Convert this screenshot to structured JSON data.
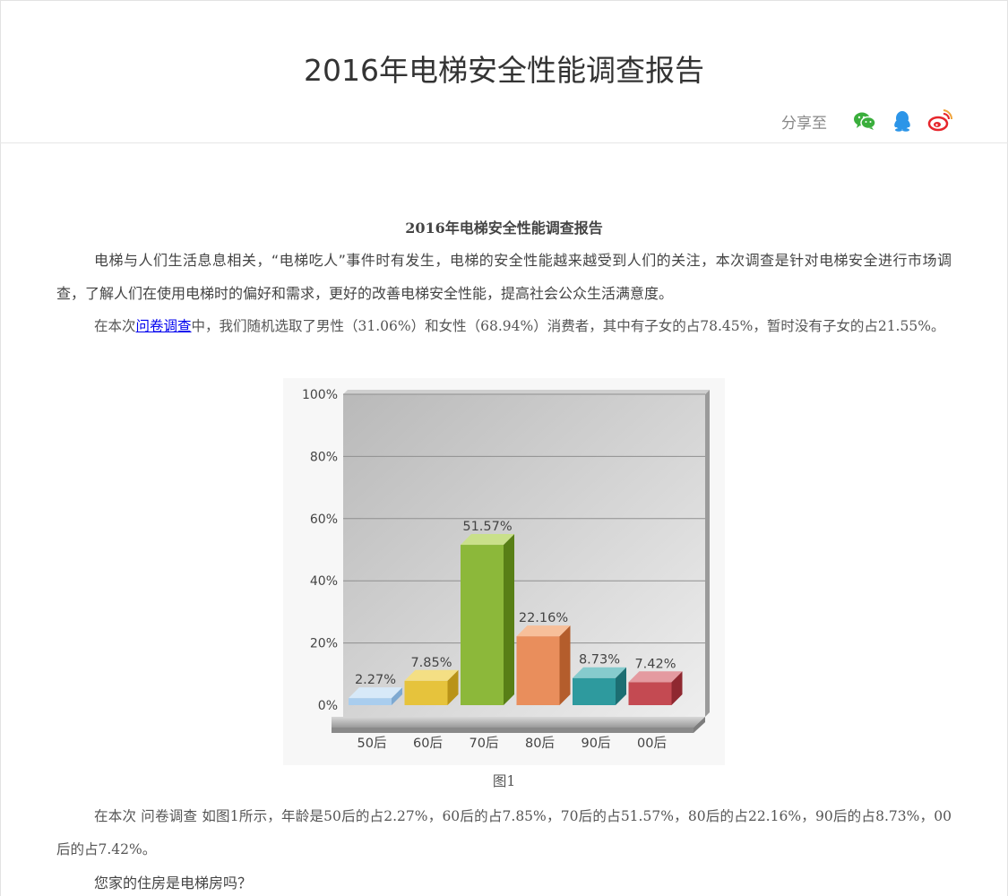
{
  "header": {
    "title": "2016年电梯安全性能调查报告",
    "share_label": "分享至",
    "share_icons": [
      "wechat-icon",
      "qq-icon",
      "weibo-icon"
    ]
  },
  "article": {
    "heading": "2016年电梯安全性能调查报告",
    "para1": "电梯与人们生活息息相关，“电梯吃人”事件时有发生，电梯的安全性能越来越受到人们的关注，本次调查是针对电梯安全进行市场调查，了解人们在使用电梯时的偏好和需求，更好的改善电梯安全性能，提高社会公众生活满意度。",
    "para2_pre": "在本次",
    "para2_link": "问卷调查",
    "para2_post": "中，我们随机选取了男性（31.06%）和女性（68.94%）消费者，其中有子女的占78.45%，暂时没有子女的占21.55%。",
    "figure_caption": "图1",
    "para3": "在本次 问卷调查 如图1所示，年龄是50后的占2.27%，60后的占7.85%，70后的占51.57%，80后的占22.16%，90后的占8.73%，00后的占7.42%。",
    "para4": "您家的住房是电梯房吗？"
  },
  "chart_data": {
    "type": "bar",
    "categories": [
      "50后",
      "60后",
      "70后",
      "80后",
      "90后",
      "00后"
    ],
    "values": [
      2.27,
      7.85,
      51.57,
      22.16,
      8.73,
      7.42
    ],
    "value_labels": [
      "2.27%",
      "7.85%",
      "51.57%",
      "22.16%",
      "8.73%",
      "7.42%"
    ],
    "yticks": [
      "0%",
      "20%",
      "40%",
      "60%",
      "80%",
      "100%"
    ],
    "ylim": [
      0,
      100
    ],
    "grid": true,
    "colors": [
      "#a9cdee",
      "#e6c33c",
      "#8cb83a",
      "#e98e5c",
      "#2e9a9e",
      "#c44a52"
    ],
    "dark_colors": [
      "#7ea9d1",
      "#b99318",
      "#587f16",
      "#b45d2c",
      "#1c6e72",
      "#8f2830"
    ],
    "light_colors": [
      "#d7e9f8",
      "#f4df84",
      "#c9e08a",
      "#f7bf9a",
      "#86cbcd",
      "#e49aa0"
    ]
  }
}
